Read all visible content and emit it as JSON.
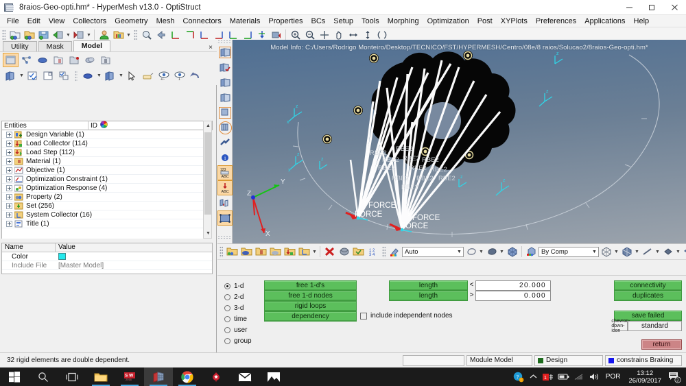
{
  "window": {
    "title": "8raios-Geo-opti.hm* - HyperMesh v13.0 - OptiStruct",
    "app_icon": "hypermesh-icon",
    "minimize": "minimize-icon",
    "maximize": "maximize-icon",
    "close": "close-icon"
  },
  "menubar": {
    "items": [
      "File",
      "Edit",
      "View",
      "Collectors",
      "Geometry",
      "Mesh",
      "Connectors",
      "Materials",
      "Properties",
      "BCs",
      "Setup",
      "Tools",
      "Morphing",
      "Optimization",
      "Post",
      "XYPlots",
      "Preferences",
      "Applications",
      "Help"
    ]
  },
  "left_panel": {
    "tabs": [
      {
        "label": "Utility",
        "active": false
      },
      {
        "label": "Mask",
        "active": false
      },
      {
        "label": "Model",
        "active": true
      }
    ],
    "close_label": "×",
    "columns": {
      "entities": "Entities",
      "id": "ID",
      "color": "color-wheel-icon"
    },
    "tree_items": [
      {
        "label": "Design Variable (1)",
        "icon": "design-variable-icon"
      },
      {
        "label": "Load Collector (114)",
        "icon": "load-collector-icon"
      },
      {
        "label": "Load Step (112)",
        "icon": "load-step-icon"
      },
      {
        "label": "Material (1)",
        "icon": "material-icon"
      },
      {
        "label": "Objective (1)",
        "icon": "objective-icon"
      },
      {
        "label": "Optimization Constraint (1)",
        "icon": "optimization-constraint-icon"
      },
      {
        "label": "Optimization Response (4)",
        "icon": "optimization-response-icon"
      },
      {
        "label": "Property (2)",
        "icon": "property-icon"
      },
      {
        "label": "Set (256)",
        "icon": "set-icon"
      },
      {
        "label": "System Collector (16)",
        "icon": "system-collector-icon"
      },
      {
        "label": "Title (1)",
        "icon": "title-icon"
      }
    ],
    "properties": {
      "headers": {
        "name": "Name",
        "value": "Value"
      },
      "rows": [
        {
          "name": "Color",
          "value": "",
          "swatch": "#24e8ec"
        },
        {
          "name": "Include File",
          "value": "[Master Model]"
        }
      ]
    }
  },
  "viewport": {
    "model_info": "Model Info: C:/Users/Rodrigo Monteiro/Desktop/TECNICO/FST/HYPERMESH/Centro/08e/8 raios/Solucao2/8raios-Geo-opti.hm*",
    "labels": {
      "force": "FORCE",
      "rbe2": "RBE2",
      "axis_x": "X",
      "axis_y": "Y",
      "axis_z": "Z"
    },
    "background_top": "#4f6f93",
    "background_bottom": "#9ba3ac"
  },
  "lower_toolbar": {
    "auto_combo": {
      "value": "Auto",
      "arrow": "chevron-down-icon"
    },
    "bycomp_combo": {
      "value": "By Comp",
      "arrow": "chevron-down-icon"
    }
  },
  "panel": {
    "entity_types": [
      {
        "label": "1-d",
        "selected": true
      },
      {
        "label": "2-d",
        "selected": false
      },
      {
        "label": "3-d",
        "selected": false
      },
      {
        "label": "time",
        "selected": false
      },
      {
        "label": "user",
        "selected": false
      },
      {
        "label": "group",
        "selected": false
      }
    ],
    "check_buttons": [
      "free 1-d's",
      "free 1-d nodes",
      "rigid loops",
      "dependency"
    ],
    "length_rows": [
      {
        "label": "length",
        "operator": "<",
        "value": "20.000"
      },
      {
        "label": "length",
        "operator": ">",
        "value": "0.000"
      }
    ],
    "include_independent": {
      "label": "include independent nodes",
      "checked": false
    },
    "right_buttons": [
      "connectivity",
      "duplicates"
    ],
    "save_failed": "save failed",
    "standard_select": {
      "value": "standard",
      "arrow": "chevron-down-icon"
    },
    "return_button": "return"
  },
  "statusbar": {
    "message": "32 rigid elements are double dependent.",
    "cells": [
      {
        "label": "",
        "swatch": ""
      },
      {
        "label": "Module Model",
        "swatch": ""
      },
      {
        "label": "Design",
        "swatch": "#1d6b1d"
      },
      {
        "label": "constrains Braking",
        "swatch": "#1414ee"
      }
    ]
  },
  "taskbar": {
    "items": [
      {
        "name": "start-button",
        "icon": "windows-logo-icon"
      },
      {
        "name": "search-button",
        "icon": "search-icon"
      },
      {
        "name": "task-view-button",
        "icon": "task-view-icon"
      },
      {
        "name": "file-explorer",
        "icon": "folder-icon"
      },
      {
        "name": "solidworks",
        "icon": "solidworks-icon"
      },
      {
        "name": "hypermesh",
        "icon": "hypermesh-icon"
      },
      {
        "name": "chrome",
        "icon": "chrome-icon"
      },
      {
        "name": "pokerstars",
        "icon": "pokerstars-icon"
      },
      {
        "name": "mail",
        "icon": "mail-icon"
      },
      {
        "name": "photos",
        "icon": "photos-icon"
      }
    ],
    "tray": {
      "action_center": "action-center-icon",
      "show_hidden": "chevron-up-icon",
      "notification_count": "1",
      "battery": "battery-icon",
      "network": "wifi-icon",
      "volume": "volume-icon",
      "language": "POR",
      "time": "13:12",
      "date": "26/09/2017",
      "notifications_badge": "3"
    }
  }
}
